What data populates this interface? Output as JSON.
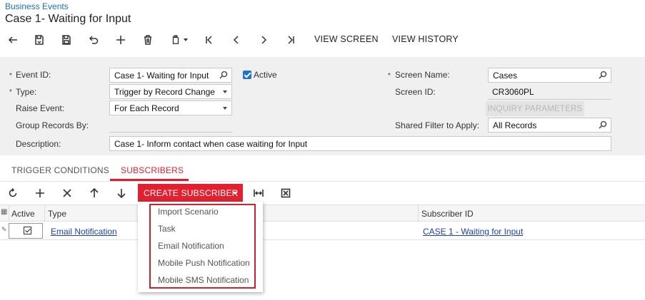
{
  "header": {
    "breadcrumb": "Business Events",
    "title": "Case 1- Waiting for Input"
  },
  "toolbar": {
    "icons": [
      "back-icon",
      "save-and-close-icon",
      "save-icon",
      "undo-icon",
      "add-icon",
      "delete-icon",
      "copy-paste-icon",
      "first-record-icon",
      "previous-record-icon",
      "next-record-icon",
      "last-record-icon"
    ],
    "view_screen": "VIEW SCREEN",
    "view_history": "VIEW HISTORY"
  },
  "form": {
    "event_id_label": "Event ID:",
    "event_id_value": "Case 1- Waiting for Input",
    "active_label": "Active",
    "active_checked": true,
    "type_label": "Type:",
    "type_value": "Trigger by Record Change",
    "raise_event_label": "Raise Event:",
    "raise_event_value": "For Each Record",
    "group_records_label": "Group Records By:",
    "group_records_value": "",
    "description_label": "Description:",
    "description_value": "Case 1- Inform contact when case waiting for Input",
    "screen_name_label": "Screen Name:",
    "screen_name_value": "Cases",
    "screen_id_label": "Screen ID:",
    "screen_id_value": "CR3060PL",
    "inquiry_parameters": "INQUIRY PARAMETERS",
    "shared_filter_label": "Shared Filter to Apply:",
    "shared_filter_value": "All Records",
    "required_marker": "*"
  },
  "tabs": [
    {
      "label": "TRIGGER CONDITIONS",
      "active": false
    },
    {
      "label": "SUBSCRIBERS",
      "active": true
    }
  ],
  "grid_toolbar": {
    "icons": [
      "refresh-icon",
      "add-row-icon",
      "delete-row-icon",
      "move-up-icon",
      "move-down-icon",
      "fit-columns-icon",
      "export-excel-icon"
    ],
    "create_subscriber": "CREATE SUBSCRIBER"
  },
  "grid": {
    "columns": [
      "Active",
      "Type",
      "Subscriber ID"
    ],
    "rows": [
      {
        "active": true,
        "type": "Email Notification",
        "subscriber_id": "CASE 1 - Waiting for Input"
      }
    ]
  },
  "create_menu": {
    "items": [
      "Import Scenario",
      "Task",
      "Email Notification",
      "Mobile Push Notification",
      "Mobile SMS Notification"
    ]
  },
  "colors": {
    "accent": "#e3202f",
    "link": "#1d3fb8",
    "checkbox": "#1f74c9"
  }
}
